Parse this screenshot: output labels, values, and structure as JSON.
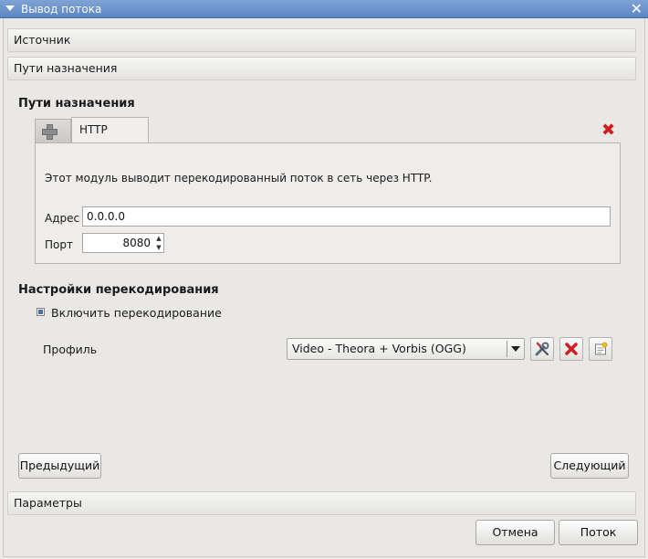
{
  "window": {
    "title": "Вывод потока",
    "close_glyph": "✕"
  },
  "sections": {
    "source": "Источник",
    "destinations": "Пути назначения",
    "options": "Параметры"
  },
  "destinations_group": {
    "title": "Пути назначения",
    "tab_label": "HTTP",
    "description": "Этот модуль выводит перекодированный поток в сеть через HTTP.",
    "address_label": "Адрес",
    "address_value": "0.0.0.0",
    "port_label": "Порт",
    "port_value": "8080",
    "remove_glyph": "✖"
  },
  "transcode_group": {
    "title": "Настройки перекодирования",
    "enable_label": "Включить перекодирование",
    "enable_checked": true,
    "profile_label": "Профиль",
    "profile_value": "Video - Theora + Vorbis (OGG)",
    "tool_icons": [
      "wrench-screwdriver-icon",
      "delete-icon",
      "new-profile-icon"
    ]
  },
  "buttons": {
    "previous": "Предыдущий",
    "next": "Следующий",
    "cancel": "Отмена",
    "stream": "Поток"
  },
  "colors": {
    "titlebar": "#6a90cb",
    "delete_red": "#d01d1d"
  }
}
